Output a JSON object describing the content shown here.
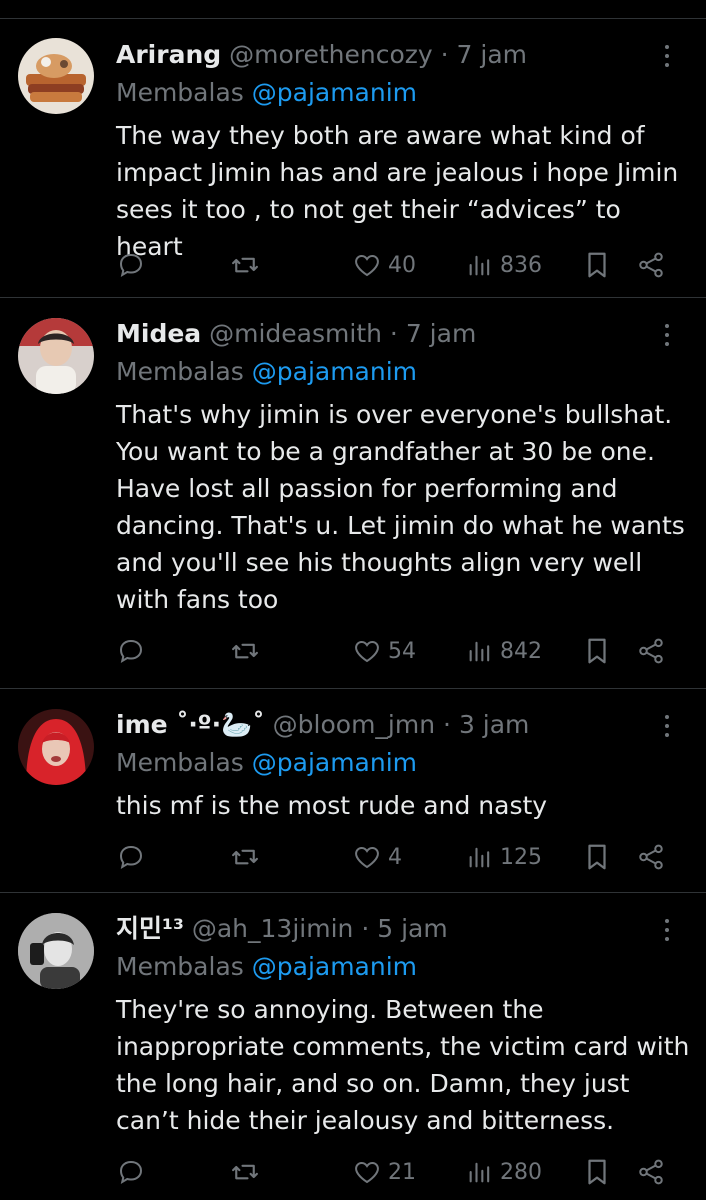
{
  "replies": [
    {
      "name": "Arirang",
      "handle": "@morethencozy",
      "sep": "·",
      "time": "7 jam",
      "replying_prefix": "Membalas",
      "replying_to": "@pajamanim",
      "text": "The way they both are aware what kind of impact Jimin has  and are jealous i hope Jimin sees it too , to not get their “advices” to heart",
      "likes": "40",
      "views": "836"
    },
    {
      "name": "Midea",
      "handle": "@mideasmith",
      "sep": "·",
      "time": "7 jam",
      "replying_prefix": "Membalas",
      "replying_to": "@pajamanim",
      "text": "That's why jimin is over everyone's bullshat. You want to be a grandfather at 30 be one. Have lost all passion for performing and dancing. That's u. Let jimin do what he wants and you'll see his thoughts align very well with fans too",
      "likes": "54",
      "views": "842"
    },
    {
      "name": "ime ˚‧º·🦢˚",
      "handle": "@bloom_jmn",
      "sep": "·",
      "time": "3 jam",
      "replying_prefix": "Membalas",
      "replying_to": "@pajamanim",
      "text": "this mf is the most rude and nasty",
      "likes": "4",
      "views": "125"
    },
    {
      "name": "지민¹³",
      "handle": "@ah_13jimin",
      "sep": "·",
      "time": "5 jam",
      "replying_prefix": "Membalas",
      "replying_to": "@pajamanim",
      "text": "They're so annoying. Between the inappropriate comments, the victim card with the long hair, and so on. Damn, they just can’t hide their jealousy and bitterness.",
      "likes": "21",
      "views": "280"
    }
  ],
  "icons": {
    "reply": "reply-icon",
    "retweet": "retweet-icon",
    "like": "heart-icon",
    "views": "views-icon",
    "bookmark": "bookmark-icon",
    "share": "share-icon",
    "more": "more-icon"
  },
  "colors": {
    "background": "#000000",
    "text": "#e7e9ea",
    "muted": "#71767b",
    "mention": "#1d9bf0",
    "divider": "#2f3336"
  }
}
